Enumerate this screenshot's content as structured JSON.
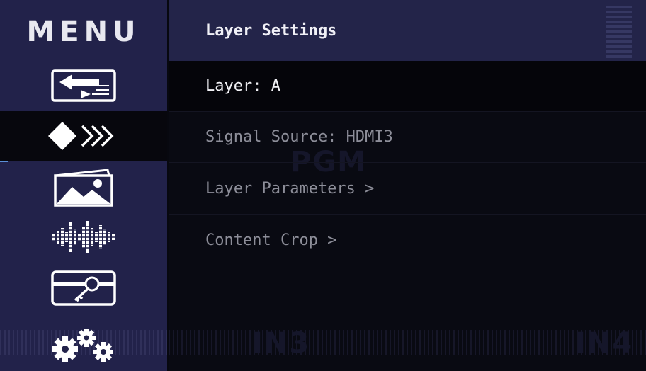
{
  "sidebar": {
    "title": "MENU",
    "items": [
      {
        "icon": "input-switch-icon",
        "active": false
      },
      {
        "icon": "layer-arrows-icon",
        "active": true
      },
      {
        "icon": "image-icon",
        "active": false
      },
      {
        "icon": "audio-waveform-icon",
        "active": false
      },
      {
        "icon": "key-card-icon",
        "active": false
      },
      {
        "icon": "gears-icon",
        "active": false
      }
    ],
    "accent_color": "#5b8fd8"
  },
  "header": {
    "title": "Layer Settings"
  },
  "rows": [
    {
      "label": "Layer: A",
      "selected": true
    },
    {
      "label": "Signal Source: HDMI3",
      "selected": false
    },
    {
      "label": "Layer Parameters >",
      "selected": false
    },
    {
      "label": "Content Crop >",
      "selected": false
    }
  ],
  "background_labels": {
    "pgm": "PGM",
    "in3": "IN3",
    "in4": "IN4"
  }
}
